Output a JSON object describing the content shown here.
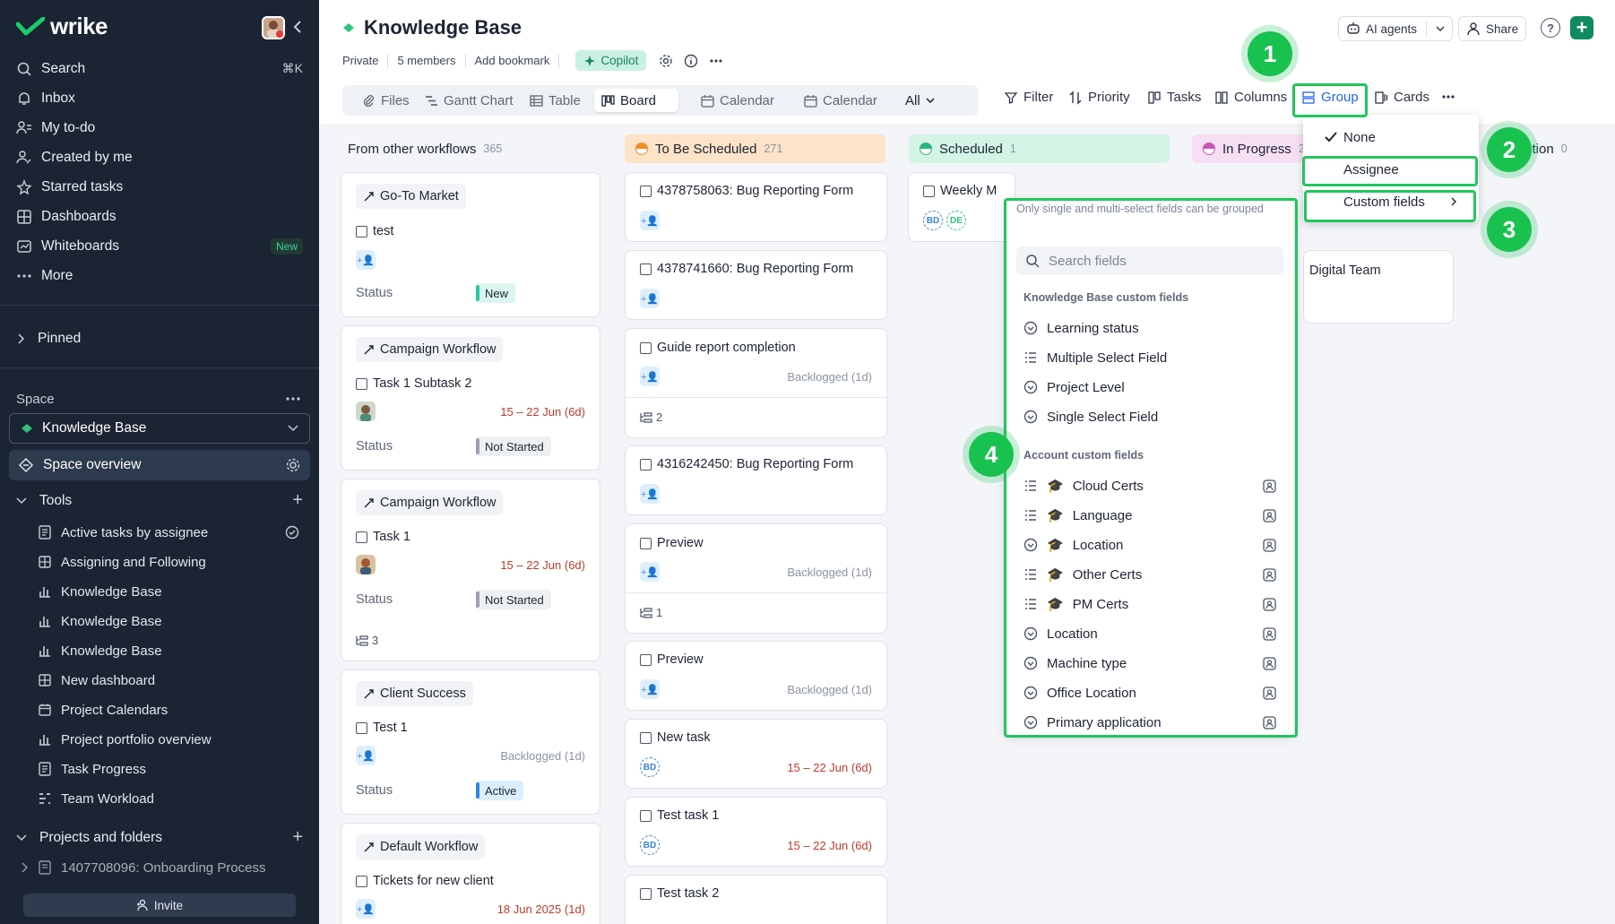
{
  "sidebar": {
    "logo_text": "wrike",
    "nav": [
      {
        "label": "Search",
        "icon": "search-icon",
        "shortcut": "⌘K"
      },
      {
        "label": "Inbox",
        "icon": "bell-icon"
      },
      {
        "label": "My to-do",
        "icon": "person-list-icon"
      },
      {
        "label": "Created by me",
        "icon": "person-edit-icon"
      },
      {
        "label": "Starred tasks",
        "icon": "star-icon"
      },
      {
        "label": "Dashboards",
        "icon": "grid-icon"
      },
      {
        "label": "Whiteboards",
        "icon": "whiteboard-icon",
        "badge": "New"
      },
      {
        "label": "More",
        "icon": "ellipsis-icon"
      }
    ],
    "pinned_label": "Pinned",
    "space_label": "Space",
    "space_selected": "Knowledge Base",
    "space_overview": "Space overview",
    "tools_label": "Tools",
    "tools": [
      "Active tasks by assignee",
      "Assigning and Following",
      "Knowledge Base",
      "Knowledge Base",
      "Knowledge Base",
      "New dashboard",
      "Project Calendars",
      "Project portfolio overview",
      "Task Progress",
      "Team Workload"
    ],
    "projects_label": "Projects and folders",
    "project_item": "1407708096: Onboarding Process",
    "invite_label": "Invite"
  },
  "header": {
    "title": "Knowledge Base",
    "privacy": "Private",
    "members": "5 members",
    "bookmark": "Add bookmark",
    "copilot": "Copilot",
    "ai_agents": "AI agents",
    "share": "Share",
    "help": "?"
  },
  "views": {
    "tabs": [
      "Files",
      "Gantt Chart",
      "Table",
      "Board",
      "Calendar",
      "Calendar",
      "All"
    ],
    "active": "Board",
    "tools": [
      "Filter",
      "Priority",
      "Tasks",
      "Columns",
      "Group",
      "Cards"
    ]
  },
  "group_menu": {
    "items": [
      "None",
      "Assignee",
      "Custom fields"
    ],
    "checked": "None"
  },
  "custom_fields_panel": {
    "note": "Only single and multi-select fields can be grouped",
    "search_placeholder": "Search fields",
    "group1_title": "Knowledge Base custom fields",
    "group1_items": [
      "Learning status",
      "Multiple Select Field",
      "Project Level",
      "Single Select Field"
    ],
    "group2_title": "Account custom fields",
    "group2_items": [
      "Cloud Certs",
      "Language",
      "Location",
      "Other Certs",
      "PM Certs",
      "Location",
      "Machine type",
      "Office Location",
      "Primary application"
    ]
  },
  "columns": [
    {
      "name": "From other workflows",
      "count": "365",
      "color": "#f3f5f8"
    },
    {
      "name": "To Be Scheduled",
      "count": "271",
      "color": "#fde3c7"
    },
    {
      "name": "Scheduled",
      "count": "1",
      "color": "#d4f4e6"
    },
    {
      "name": "In Progress",
      "count": "2",
      "color": "#f7dff3"
    },
    {
      "name": "y Question",
      "count": "0",
      "color": "#f3f5f8"
    }
  ],
  "col1_cards": [
    {
      "workflow": "Go-To Market",
      "task": "test",
      "status_label": "Status",
      "status": "New"
    },
    {
      "workflow": "Campaign Workflow",
      "task": "Task 1 Subtask 2",
      "date": "15 – 22 Jun (6d)",
      "status_label": "Status",
      "status": "Not Started"
    },
    {
      "workflow": "Campaign Workflow",
      "task": "Task 1",
      "date": "15 – 22 Jun (6d)",
      "status_label": "Status",
      "status": "Not Started",
      "subtasks": "3"
    },
    {
      "workflow": "Client Success",
      "task": "Test 1",
      "backlog": "Backlogged (1d)",
      "status_label": "Status",
      "status": "Active"
    },
    {
      "workflow": "Default Workflow",
      "task": "Tickets for new client",
      "date": "18 Jun 2025 (1d)"
    }
  ],
  "col2_cards": [
    {
      "task": "4378758063: Bug Reporting Form"
    },
    {
      "task": "4378741660: Bug Reporting Form"
    },
    {
      "task": "Guide report completion",
      "backlog": "Backlogged (1d)",
      "subtasks": "2"
    },
    {
      "task": "4316242450: Bug Reporting Form"
    },
    {
      "task": "Preview",
      "backlog": "Backlogged (1d)",
      "subtasks": "1"
    },
    {
      "task": "Preview",
      "backlog": "Backlogged (1d)"
    },
    {
      "task": "New task",
      "date": "15 – 22 Jun (6d)",
      "initials": "BD"
    },
    {
      "task": "Test task 1",
      "date": "15 – 22 Jun (6d)",
      "initials": "BD"
    },
    {
      "task": "Test task 2"
    }
  ],
  "col3_card": {
    "task": "Weekly M",
    "initials": [
      "BD",
      "DE"
    ]
  },
  "col4_card": {
    "task": "Digital Team"
  },
  "annotations": [
    "1",
    "2",
    "3",
    "4"
  ],
  "colors": {
    "accent": "#22c55e",
    "brand": "#0f8b5f",
    "sidebar_bg": "#1b2433",
    "link": "#2563eb"
  }
}
